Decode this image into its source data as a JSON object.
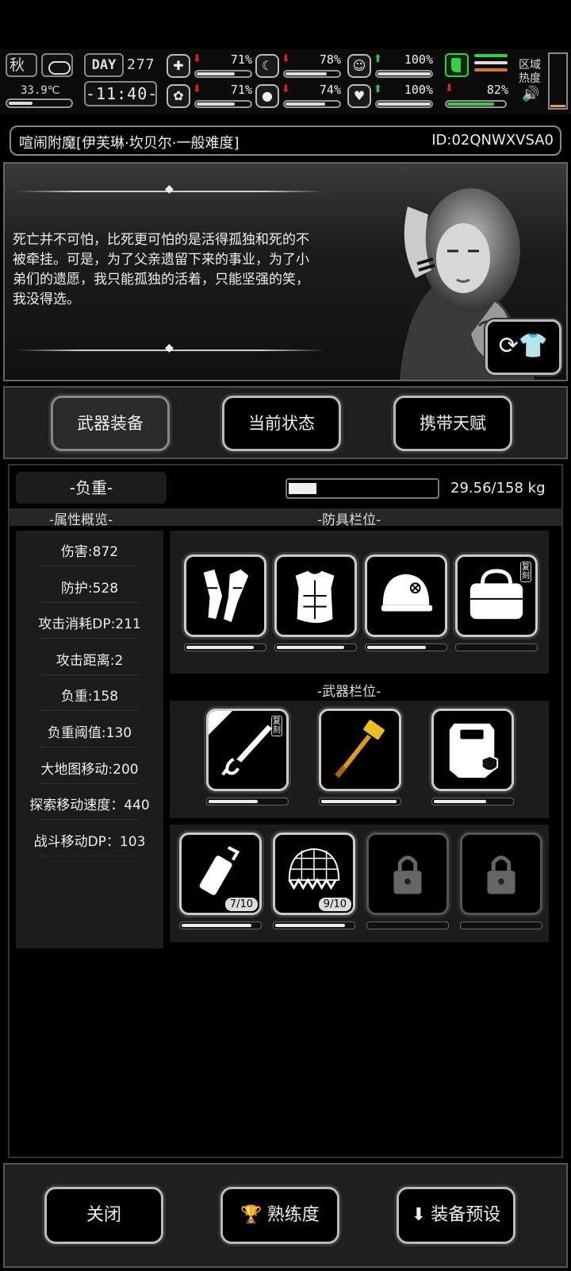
{
  "status": {
    "season": "秋",
    "temperature": "33.9℃",
    "day_label": "DAY",
    "day_number": "277",
    "clock": "-11:40-",
    "stats": [
      {
        "icon": "medkit-icon",
        "glyph": "✚",
        "trend": "down",
        "value": "71%",
        "level": 0.71
      },
      {
        "icon": "stomach-icon",
        "glyph": "☾",
        "trend": "down",
        "value": "78%",
        "level": 0.78
      },
      {
        "icon": "mood-icon",
        "glyph": "☺",
        "trend": "up",
        "value": "100%",
        "level": 1.0
      },
      {
        "icon": "brain-icon",
        "glyph": "✿",
        "trend": "down",
        "value": "71%",
        "level": 0.71
      },
      {
        "icon": "water-drop-icon",
        "glyph": "●",
        "trend": "down",
        "value": "74%",
        "level": 0.74
      },
      {
        "icon": "heart-icon",
        "glyph": "♥",
        "trend": "up",
        "value": "100%",
        "level": 1.0
      }
    ],
    "stamina": {
      "trend": "down",
      "value": "82%",
      "level": 0.82
    },
    "region_heat_label": "区域热度",
    "colors": {
      "stamina": "#32d04a",
      "alert": "#e02020",
      "heat": "#e07030"
    }
  },
  "title": {
    "name": "喧闹附魔[伊芙琳·坎贝尔·一般难度]",
    "id": "ID:02QNWXVSA0"
  },
  "portrait": {
    "quote": "死亡并不可怕，比死更可怕的是活得孤独和死的不被牵挂。可是，为了父亲遗留下来的事业，为了小弟们的遗愿，我只能孤独的活着，只能坚强的笑，我没得选。"
  },
  "tabs": [
    {
      "label": "武器装备",
      "active": true
    },
    {
      "label": "当前状态",
      "active": false
    },
    {
      "label": "携带天赋",
      "active": false
    }
  ],
  "load": {
    "label": "-负重-",
    "value": "29.56/158 kg",
    "fraction": 0.187
  },
  "headers": {
    "attributes": "-属性概览-",
    "armor": "-防具栏位-",
    "weapons": "-武器栏位-"
  },
  "attributes": [
    "伤害:872",
    "防护:528",
    "攻击消耗DP:211",
    "攻击距离:2",
    "负重:158",
    "负重阈值:130",
    "大地图移动:200",
    "探索移动速度：440",
    "战斗移动DP：103"
  ],
  "armor_slots": [
    {
      "name": "gauntlets-icon",
      "durability": 0.87
    },
    {
      "name": "body-armor-icon",
      "durability": 0.87
    },
    {
      "name": "helmet-icon",
      "durability": 0.75
    },
    {
      "name": "bag-icon",
      "durability": null,
      "tag": "复刻"
    }
  ],
  "weapon_slots": [
    {
      "name": "sword-icon",
      "durability": 0.63,
      "tag": "复刻"
    },
    {
      "name": "hammer-icon",
      "durability": 0.97
    },
    {
      "name": "riot-shield-icon",
      "durability": 0.67
    }
  ],
  "item_slots": [
    {
      "name": "syringe-icon",
      "count": "7/10",
      "durability": 0.9
    },
    {
      "name": "net-trap-icon",
      "count": "9/10",
      "durability": 0.9
    },
    {
      "name": "lock-icon",
      "locked": true
    },
    {
      "name": "lock-icon",
      "locked": true
    }
  ],
  "bottom": {
    "close": "关闭",
    "proficiency": "熟练度",
    "preset": "装备预设"
  }
}
